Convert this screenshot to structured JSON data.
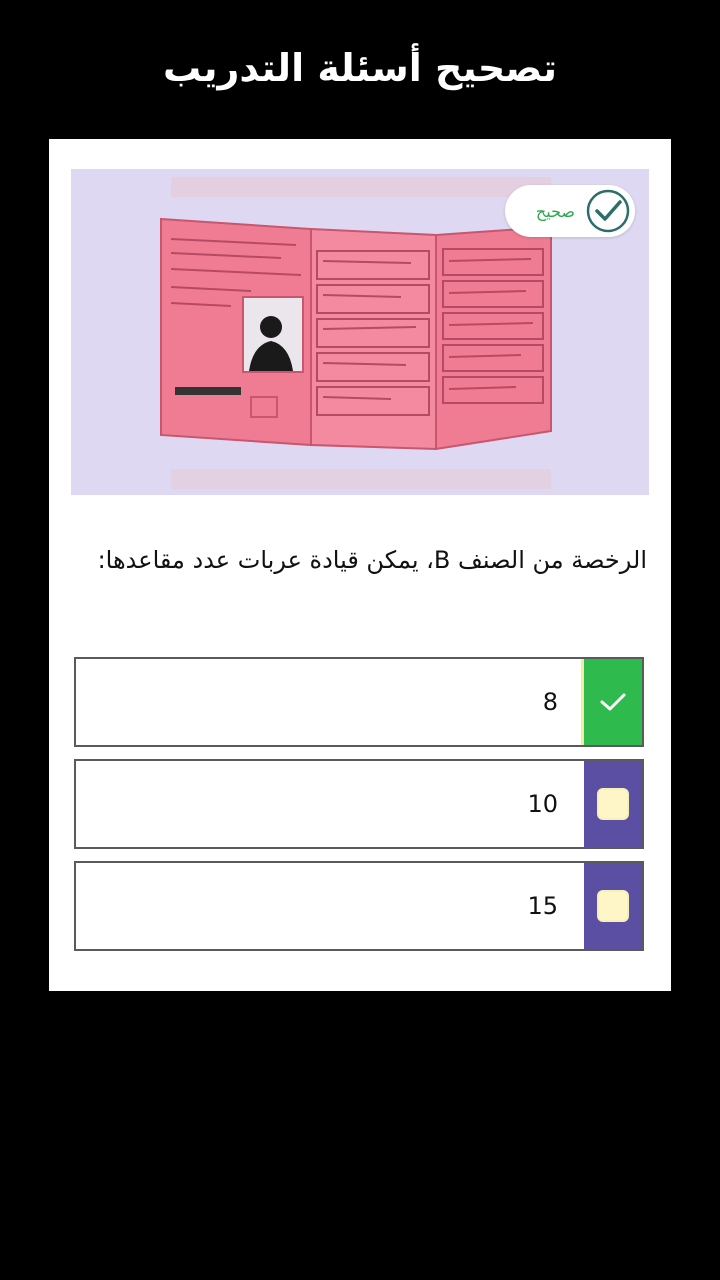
{
  "header": {
    "title": "تصحيح أسئلة التدريب"
  },
  "illustration": {
    "badge_label": "صحيح",
    "badge_icon": "check-circle-icon",
    "image_subject": "driving-license-document"
  },
  "question": {
    "text": "الرخصة من الصنف B، يمكن قيادة عربات عدد مقاعدها:"
  },
  "answers": [
    {
      "value": "8",
      "state": "correct",
      "marker_icon": "checkmark-icon"
    },
    {
      "value": "10",
      "state": "unselected",
      "marker_icon": "checkbox-icon"
    },
    {
      "value": "15",
      "state": "unselected",
      "marker_icon": "checkbox-icon"
    }
  ],
  "colors": {
    "correct_green": "#2fba4e",
    "option_purple": "#5b4fa3",
    "license_pink": "#f07c93",
    "illustration_bg": "#ded8f2"
  }
}
